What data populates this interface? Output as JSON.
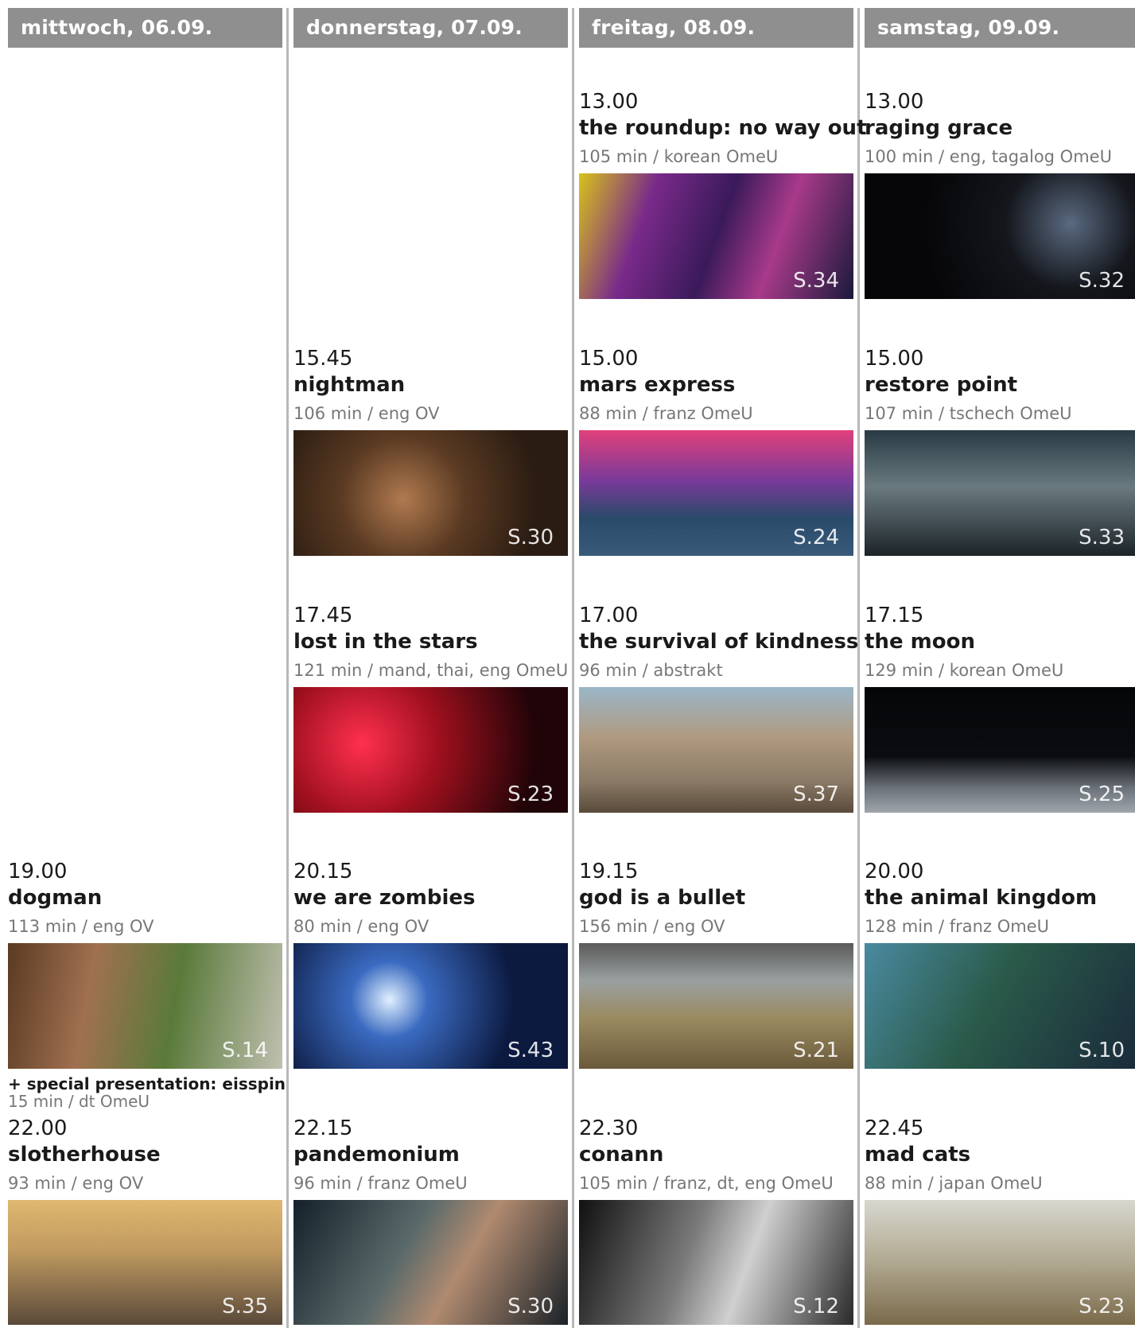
{
  "days": [
    {
      "header": "mittwoch, 06.09.",
      "shows": [
        {
          "time": "19.00",
          "title": "dogman",
          "meta": "113 min / eng OV",
          "page": "S.14",
          "extra_title": "+ special presentation: eisspin",
          "extra_meta": "15 min / dt OmeU"
        },
        {
          "time": "22.00",
          "title": "slotherhouse",
          "meta": "93 min / eng OV",
          "page": "S.35"
        }
      ]
    },
    {
      "header": "donnerstag, 07.09.",
      "shows": [
        {
          "time": "15.45",
          "title": "nightman",
          "meta": "106 min / eng OV",
          "page": "S.30"
        },
        {
          "time": "17.45",
          "title": "lost in the stars",
          "meta": "121 min / mand, thai, eng OmeU",
          "page": "S.23"
        },
        {
          "time": "20.15",
          "title": "we are zombies",
          "meta": "80 min / eng OV",
          "page": "S.43"
        },
        {
          "time": "22.15",
          "title": "pandemonium",
          "meta": "96 min / franz OmeU",
          "page": "S.30"
        }
      ]
    },
    {
      "header": "freitag, 08.09.",
      "shows": [
        {
          "time": "13.00",
          "title": "the roundup: no way out",
          "meta": "105 min / korean OmeU",
          "page": "S.34"
        },
        {
          "time": "15.00",
          "title": "mars express",
          "meta": "88 min / franz OmeU",
          "page": "S.24"
        },
        {
          "time": "17.00",
          "title": "the survival of kindness",
          "meta": "96 min / abstrakt",
          "page": "S.37"
        },
        {
          "time": "19.15",
          "title": "god is a bullet",
          "meta": "156 min / eng OV",
          "page": "S.21"
        },
        {
          "time": "22.30",
          "title": "conann",
          "meta": "105 min / franz, dt, eng OmeU",
          "page": "S.12"
        }
      ]
    },
    {
      "header": "samstag, 09.09.",
      "shows": [
        {
          "time": "13.00",
          "title": "raging grace",
          "meta": "100 min / eng, tagalog OmeU",
          "page": "S.32"
        },
        {
          "time": "15.00",
          "title": "restore point",
          "meta": "107 min / tschech OmeU",
          "page": "S.33"
        },
        {
          "time": "17.15",
          "title": "the moon",
          "meta": "129 min / korean OmeU",
          "page": "S.25"
        },
        {
          "time": "20.00",
          "title": "the animal kingdom",
          "meta": "128 min / franz OmeU",
          "page": "S.10"
        },
        {
          "time": "22.45",
          "title": "mad cats",
          "meta": "88 min / japan OmeU",
          "page": "S.23"
        }
      ]
    }
  ]
}
